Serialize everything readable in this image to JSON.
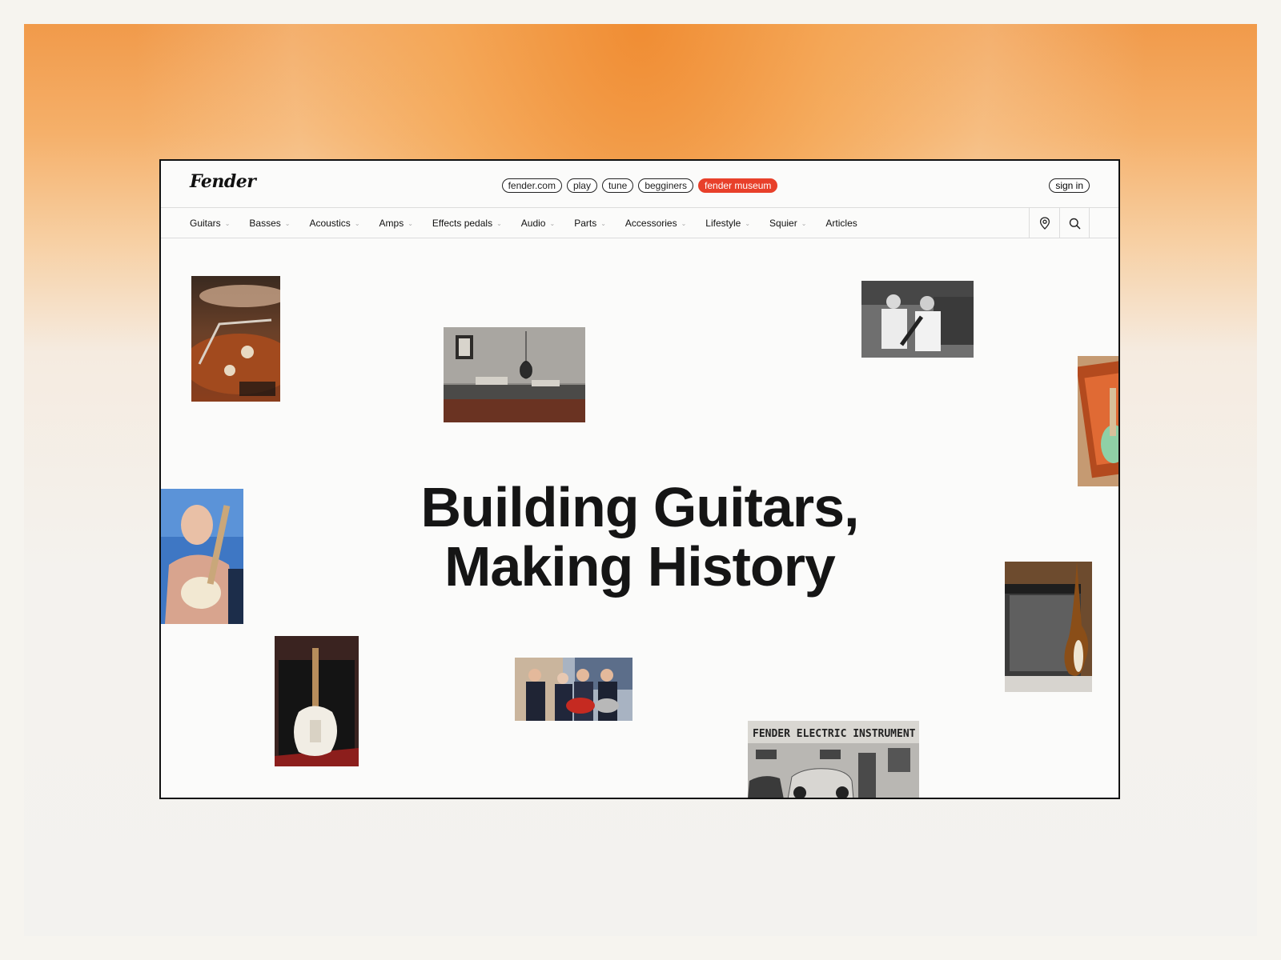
{
  "brand": {
    "logo_text": "Fender"
  },
  "topbar": {
    "pills": [
      {
        "label": "fender.com",
        "active": false
      },
      {
        "label": "play",
        "active": false
      },
      {
        "label": "tune",
        "active": false
      },
      {
        "label": "begginers",
        "active": false
      },
      {
        "label": "fender museum",
        "active": true
      }
    ],
    "signin_label": "sign in"
  },
  "nav": {
    "items": [
      {
        "label": "Guitars",
        "has_dropdown": true
      },
      {
        "label": "Basses",
        "has_dropdown": true
      },
      {
        "label": "Acoustics",
        "has_dropdown": true
      },
      {
        "label": "Amps",
        "has_dropdown": true
      },
      {
        "label": "Effects pedals",
        "has_dropdown": true
      },
      {
        "label": "Audio",
        "has_dropdown": true
      },
      {
        "label": "Parts",
        "has_dropdown": true
      },
      {
        "label": "Accessories",
        "has_dropdown": true
      },
      {
        "label": "Lifestyle",
        "has_dropdown": true
      },
      {
        "label": "Squier",
        "has_dropdown": true
      },
      {
        "label": "Articles",
        "has_dropdown": false
      }
    ],
    "icons": [
      "location-pin-icon",
      "search-icon"
    ]
  },
  "hero": {
    "line1": "Building Guitars,",
    "line2": "Making History"
  },
  "photos": {
    "factory_sign_text": "FENDER ELECTRIC INSTRUMENT"
  },
  "colors": {
    "accent": "#e8402a",
    "gradient_top": "#f19a4a",
    "page_bg": "#fbfbfa"
  }
}
